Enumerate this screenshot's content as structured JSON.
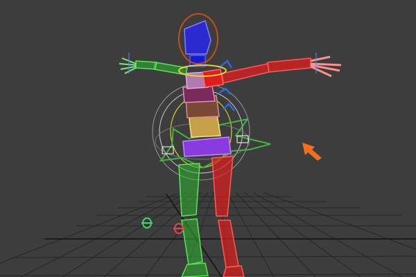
{
  "viewport": {
    "background": "#3d3d3d",
    "grid_color": "#2a2a2a"
  },
  "rig": {
    "left_side_color": "#2fb52f",
    "right_side_color": "#e01d1d",
    "spine_color": "#b07ab0",
    "pelvis_color": "#8a3be0",
    "head_color": "#2a2ad0",
    "head_gizmo_color": "#c0501a",
    "root_star_color": "#3fb83f",
    "selection_arrow_color": "#f07020",
    "rotate_gizmo_color": "#2a6ae0"
  },
  "icons": {
    "selection_arrow": "arrow-icon",
    "left_foot_marker": "foot-marker-icon",
    "right_foot_marker": "foot-marker-icon"
  }
}
